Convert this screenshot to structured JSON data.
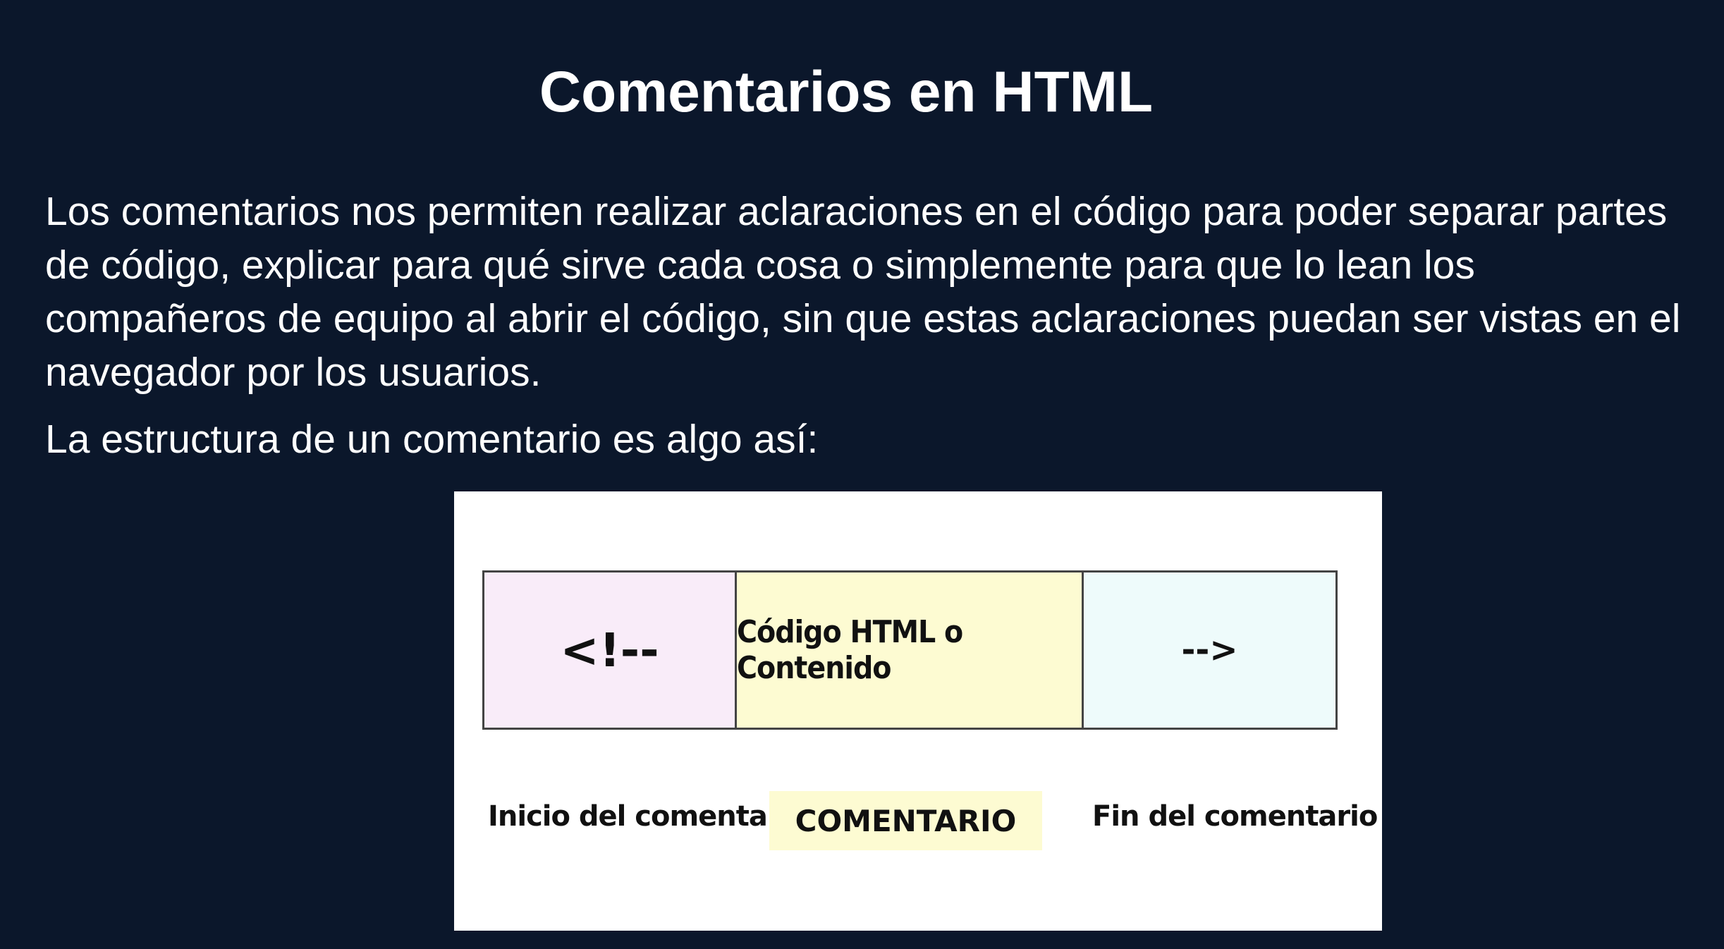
{
  "slide": {
    "title": "Comentarios en HTML",
    "paragraph": "Los comentarios nos permiten realizar aclaraciones en el código para poder separar partes de código, explicar para qué sirve cada cosa o simplemente para que lo lean los compañeros de equipo al abrir el código, sin que estas aclaraciones puedan ser vistas en el navegador por los usuarios.",
    "structure_intro": "La estructura de un comentario es algo así:"
  },
  "diagram": {
    "cells": {
      "start": "<!--",
      "code": "Código HTML o Contenido",
      "end": "-->"
    },
    "labels": {
      "start": "Inicio del comentario",
      "middle": "COMENTARIO",
      "end": "Fin del comentario"
    },
    "colors": {
      "start_cell": "#f9ecf9",
      "code_cell": "#fdfbd2",
      "end_cell": "#eefbfb",
      "slide_background": "#0b172b"
    }
  }
}
